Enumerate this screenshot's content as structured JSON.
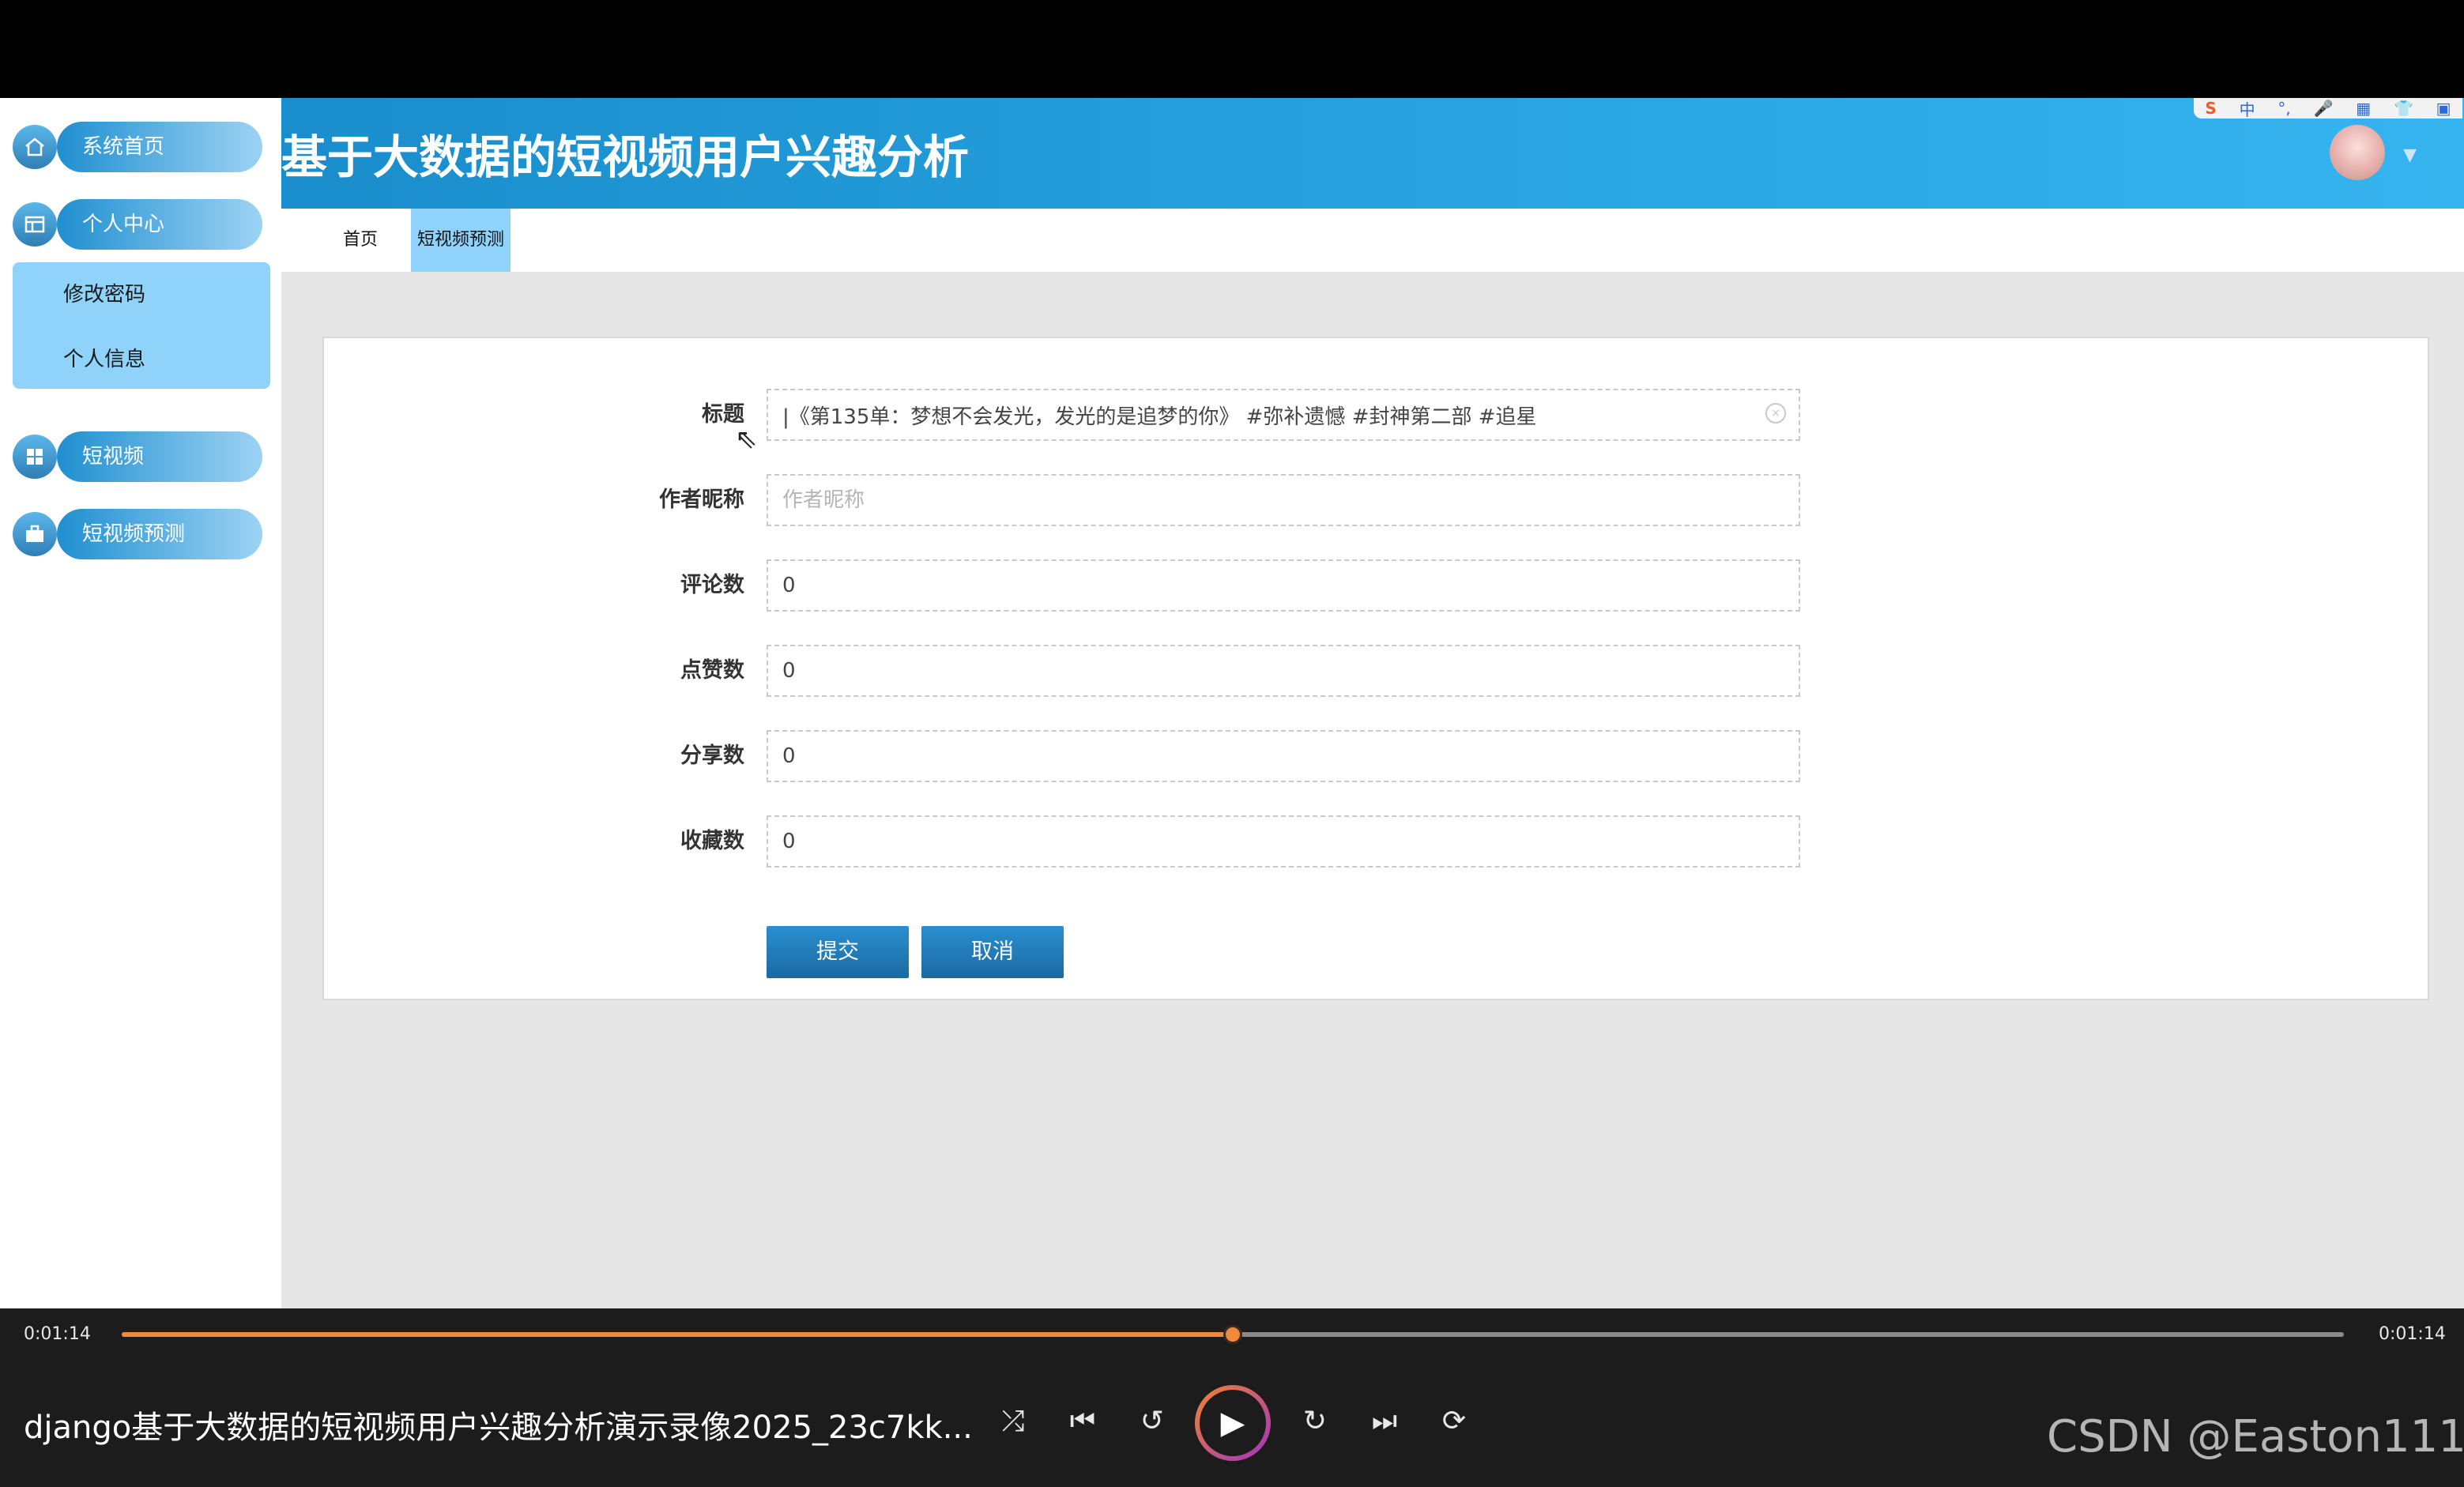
{
  "app": {
    "title": "基于大数据的短视频用户兴趣分析",
    "ime_icons": [
      "S",
      "中",
      "°,",
      "🎤",
      "▦",
      "👕",
      "▣"
    ]
  },
  "sidebar": {
    "items": [
      {
        "label": "系统首页",
        "icon": "home-icon"
      },
      {
        "label": "个人中心",
        "icon": "card-icon"
      },
      {
        "label": "短视频",
        "icon": "grid-icon"
      },
      {
        "label": "短视频预测",
        "icon": "briefcase-icon"
      }
    ],
    "submenu": [
      {
        "label": "修改密码"
      },
      {
        "label": "个人信息"
      }
    ]
  },
  "tabs": [
    {
      "label": "首页"
    },
    {
      "label": "短视频预测",
      "active": true
    }
  ],
  "form": {
    "fields": [
      {
        "label": "标题",
        "value": "|《第135单：梦想不会发光，发光的是追梦的你》 #弥补遗憾 #封神第二部 #追星",
        "placeholder": ""
      },
      {
        "label": "作者昵称",
        "value": "",
        "placeholder": "作者昵称"
      },
      {
        "label": "评论数",
        "value": "0",
        "placeholder": ""
      },
      {
        "label": "点赞数",
        "value": "0",
        "placeholder": ""
      },
      {
        "label": "分享数",
        "value": "0",
        "placeholder": ""
      },
      {
        "label": "收藏数",
        "value": "0",
        "placeholder": ""
      }
    ],
    "submit_label": "提交",
    "cancel_label": "取消"
  },
  "player": {
    "current_time": "0:01:14",
    "total_time": "0:01:14",
    "progress": 0.5,
    "video_title": "django基于大数据的短视频用户兴趣分析演示录像2025_23c7kk...",
    "watermark": "CSDN @Easton111",
    "accent_color": "#f08a3a"
  }
}
